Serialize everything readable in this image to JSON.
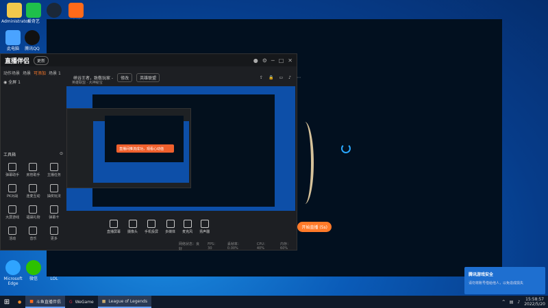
{
  "desktop": {
    "icons": [
      {
        "label": "Administrator"
      },
      {
        "label": "爱奇艺"
      },
      {
        "label": "Steam"
      },
      {
        "label": "直播"
      },
      {
        "label": "此电脑"
      },
      {
        "label": "腾讯QQ"
      },
      {
        "label": "Microsoft Edge"
      },
      {
        "label": "微信"
      },
      {
        "label": "LOL"
      }
    ]
  },
  "app": {
    "logo": "直播伴侣",
    "logo_badge": "更新",
    "tabs": [
      "动作场景",
      "场景",
      "可添加",
      "场景 1"
    ],
    "scene_item": "全屏 1",
    "title_text": "峡谷王者，致敬玩家 -",
    "title_pill": "修改",
    "category_pill": "英雄联盟",
    "sub_text": "英雄联盟 · 大神秘宝",
    "tools_title": "工具箱",
    "tools": [
      "弹幕助手",
      "房管助手",
      "主播任务",
      "PK对战",
      "连麦互动",
      "抽奖玩法",
      "大屏游戏",
      "福袋礼物",
      "弹幕卡",
      "活动",
      "音乐",
      "更多"
    ],
    "toast": "直播间推流成功，观看心动值",
    "bottom_items": [
      "直播屏幕",
      "摄像头",
      "手机投屏",
      "多媒体",
      "麦克风",
      "扬声器"
    ],
    "live_button": "开始直播 (5s)",
    "status": [
      "网络状态：良好",
      "FPS：30",
      "丢帧率：0.00%",
      "CPU：40%",
      "内存：60%"
    ]
  },
  "notification": {
    "title": "腾讯游戏安全",
    "body": "请勿将账号借给他人，以免造成损失"
  },
  "taskbar": {
    "tasks": [
      {
        "label": "斗鱼直播伴侣"
      },
      {
        "label": "WeGame"
      },
      {
        "label": "League of Legends"
      }
    ],
    "time": "15:58:57",
    "date": "2022/5/20"
  }
}
